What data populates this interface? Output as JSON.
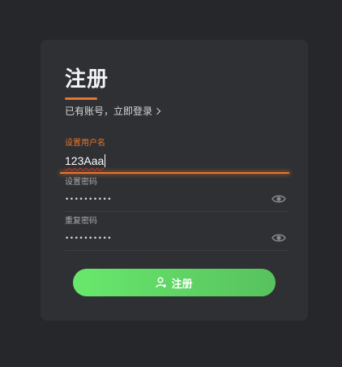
{
  "form": {
    "title": "注册",
    "login_link": "已有账号，立即登录",
    "username": {
      "label": "设置用户名",
      "value": "123Aaa"
    },
    "password": {
      "label": "设置密码",
      "value": "••••••••••"
    },
    "confirm_password": {
      "label": "重复密码",
      "value": "••••••••••"
    },
    "submit_label": "注册"
  },
  "colors": {
    "background": "#25272b",
    "card": "#2e3034",
    "accent": "#e8752b",
    "button_start": "#69e86c",
    "button_end": "#57c25e"
  },
  "icons": [
    "chevron-right-icon",
    "eye-icon",
    "user-add-icon"
  ]
}
